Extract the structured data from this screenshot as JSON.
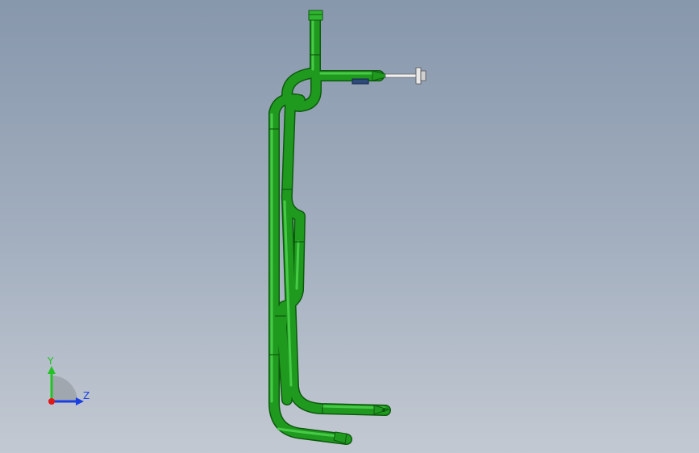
{
  "viewport": {
    "background_top": "#8797ac",
    "background_bottom": "#c3c9d2"
  },
  "model": {
    "pipe_color": "#1f9a1f",
    "pipe_highlight": "#4fd44f",
    "pipe_shadow": "#0c5a0c",
    "fitting_color": "#2e4a7a"
  },
  "triad": {
    "y_label": "Y",
    "z_label": "Z",
    "y_color": "#22c322",
    "z_color": "#1a3fe0",
    "x_color": "#e01818"
  }
}
